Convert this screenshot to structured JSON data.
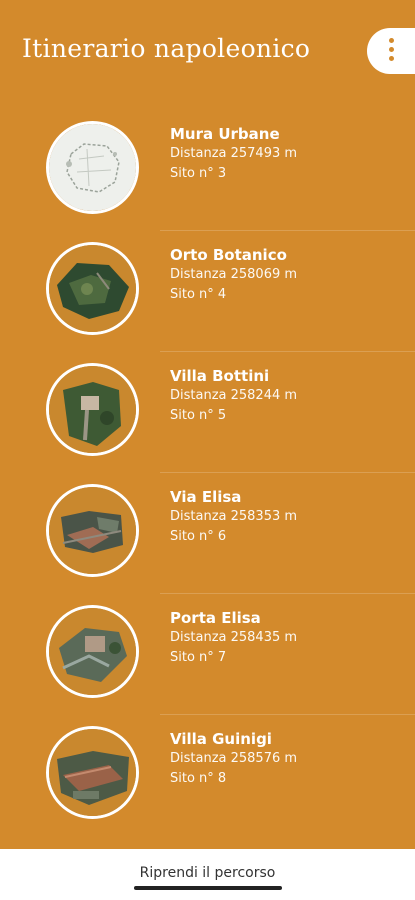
{
  "header": {
    "title": "Itinerario napoleonico",
    "menu_icon": "more-vertical-icon"
  },
  "sites": [
    {
      "name": "Mura Urbane",
      "distance": "Distanza 257493 m",
      "site": "Sito n° 3",
      "thumb": "map"
    },
    {
      "name": "Orto Botanico",
      "distance": "Distanza 258069 m",
      "site": "Sito n° 4",
      "thumb": "aerial"
    },
    {
      "name": "Villa Bottini",
      "distance": "Distanza 258244 m",
      "site": "Sito n° 5",
      "thumb": "aerial"
    },
    {
      "name": "Via Elisa",
      "distance": "Distanza 258353 m",
      "site": "Sito n° 6",
      "thumb": "aerial"
    },
    {
      "name": "Porta Elisa",
      "distance": "Distanza 258435 m",
      "site": "Sito n° 7",
      "thumb": "aerial"
    },
    {
      "name": "Villa Guinigi",
      "distance": "Distanza 258576 m",
      "site": "Sito n° 8",
      "thumb": "aerial"
    }
  ],
  "footer": {
    "resume_label": "Riprendi il percorso"
  },
  "colors": {
    "background": "#D38A2C",
    "accent_white": "#FFFFFF"
  }
}
